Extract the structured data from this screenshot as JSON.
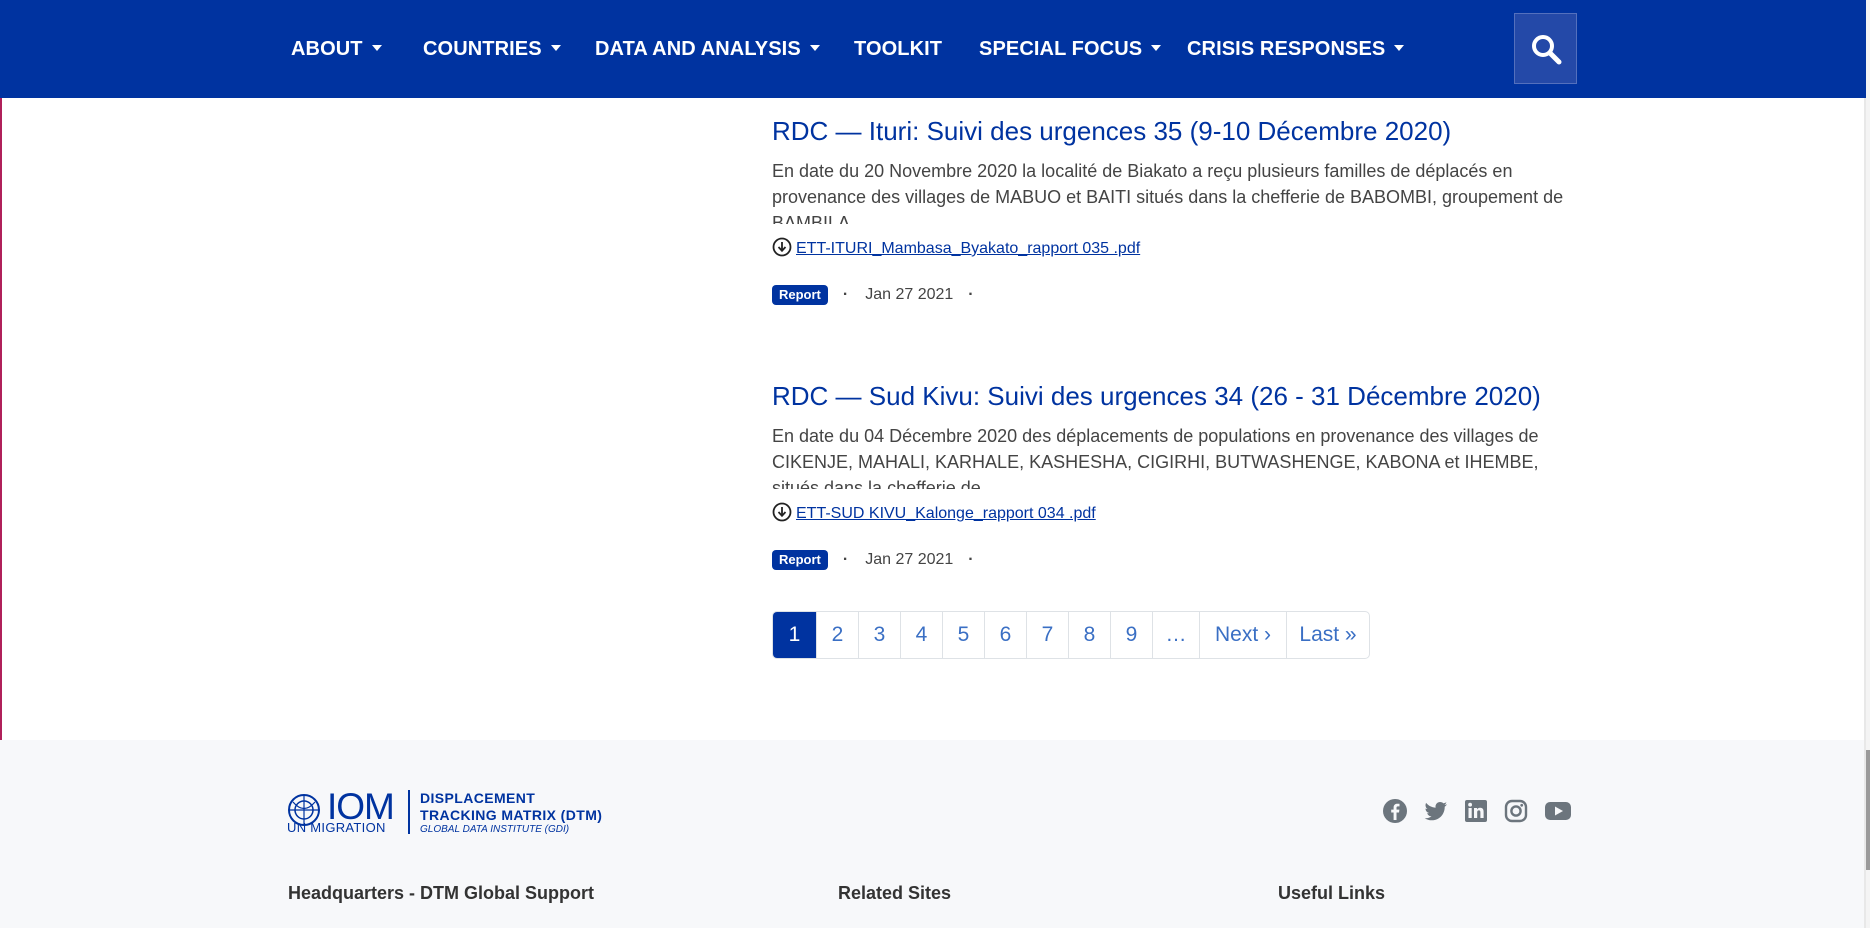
{
  "nav": {
    "items": [
      {
        "label": "ABOUT",
        "has_dropdown": true
      },
      {
        "label": "COUNTRIES",
        "has_dropdown": true
      },
      {
        "label": "DATA AND ANALYSIS",
        "has_dropdown": true
      },
      {
        "label": "TOOLKIT",
        "has_dropdown": false
      },
      {
        "label": "SPECIAL FOCUS",
        "has_dropdown": true
      },
      {
        "label": "CRISIS RESPONSES",
        "has_dropdown": true
      }
    ],
    "search_icon": "search-icon",
    "background_color": "#0033a0"
  },
  "articles": [
    {
      "title": "RDC — Ituri: Suivi des urgences 35 (9-10 Décembre 2020)",
      "summary": "En date du 20 Novembre 2020 la localité de Biakato a reçu plusieurs familles de déplacés en provenance des villages de MABUO et BAITI situés dans la chefferie de BABOMBI, groupement de BAMBILA",
      "file": "ETT-ITURI_Mambasa_Byakato_rapport 035 .pdf",
      "badge": "Report",
      "date": "Jan 27 2021",
      "separator": "·"
    },
    {
      "title": "RDC — Sud Kivu: Suivi des urgences 34 (26 - 31 Décembre 2020)",
      "summary": "En date du 04 Décembre 2020 des déplacements de populations en provenance des villages de CIKENJE, MAHALI, KARHALE, KASHESHA, CIGIRHI, BUTWASHENGE, KABONA et IHEMBE, situés dans la chefferie de",
      "file": "ETT-SUD KIVU_Kalonge_rapport 034 .pdf",
      "badge": "Report",
      "date": "Jan 27 2021",
      "separator": "·"
    }
  ],
  "pagination": {
    "current": "1",
    "pages": [
      "1",
      "2",
      "3",
      "4",
      "5",
      "6",
      "7",
      "8",
      "9",
      "…",
      "Next ›",
      "Last »"
    ]
  },
  "footer": {
    "logo": {
      "org": "IOM",
      "org_sub": "UN MIGRATION",
      "product_line1": "DISPLACEMENT",
      "product_line2": "TRACKING MATRIX (DTM)",
      "product_line3": "GLOBAL DATA INSTITUTE (GDI)"
    },
    "social_icons": [
      "facebook-icon",
      "twitter-icon",
      "linkedin-icon",
      "instagram-icon",
      "youtube-icon"
    ],
    "headings": [
      "Headquarters - DTM Global Support",
      "Related Sites",
      "Useful Links"
    ]
  }
}
